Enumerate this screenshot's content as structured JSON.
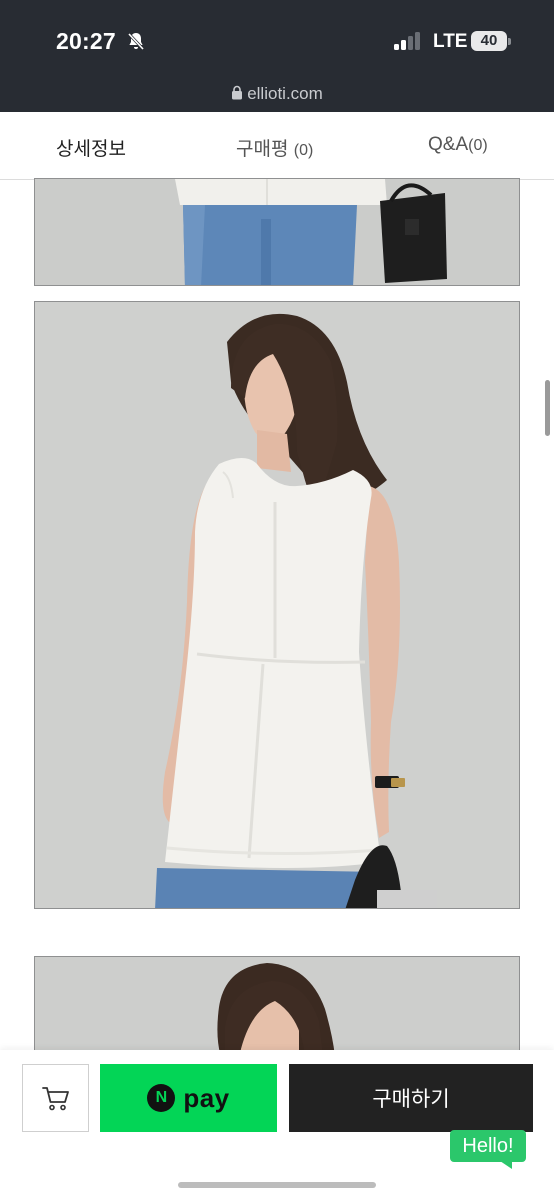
{
  "status_bar": {
    "time": "20:27",
    "network": "LTE",
    "battery": "40",
    "url": "ellioti.com"
  },
  "tabs": [
    {
      "label": "상세정보",
      "count": "",
      "active": true
    },
    {
      "label": "구매평",
      "count": "(0)",
      "active": false
    },
    {
      "label": "Q&A",
      "count": "(0)",
      "active": false
    }
  ],
  "photos": [
    {
      "description_icon": "product-photo"
    },
    {
      "description_icon": "product-photo"
    },
    {
      "description_icon": "product-photo"
    }
  ],
  "bottom_bar": {
    "npay_letter": "N",
    "npay_label": "pay",
    "buy_label": "구매하기",
    "chat_label": "Hello!"
  },
  "colors": {
    "status_bar_bg": "#282c33",
    "npay_green": "#03d556",
    "buy_button": "#222222",
    "chat_green": "#2bc76b"
  }
}
